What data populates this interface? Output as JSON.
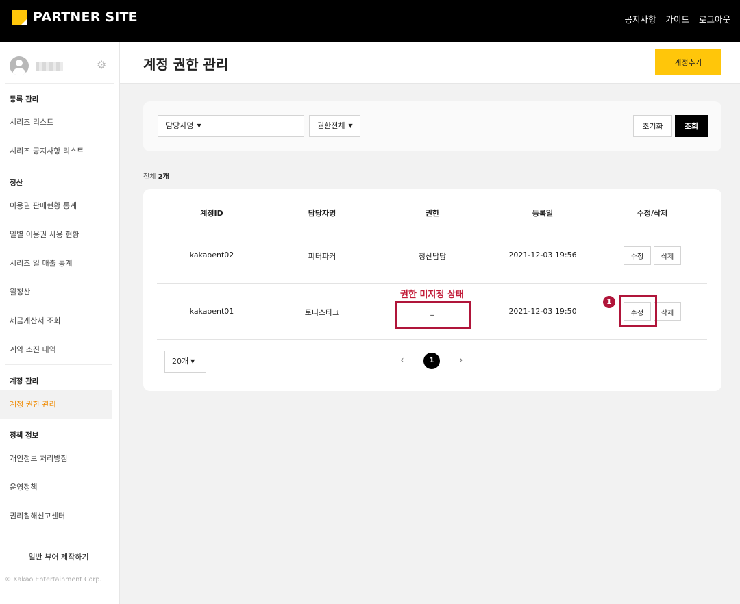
{
  "header": {
    "brand": "PARTNER SITE",
    "nav": [
      "공지사항",
      "가이드",
      "로그아웃"
    ]
  },
  "sidebar": {
    "sections": [
      {
        "title": "등록 관리",
        "items": [
          "시리즈 리스트",
          "시리즈 공지사항 리스트"
        ]
      },
      {
        "title": "정산",
        "items": [
          "이용권 판매현황 통계",
          "일별 이용권 사용 현황",
          "시리즈 일 매출 통계",
          "월정산",
          "세금계산서 조회",
          "계약 소진 내역"
        ]
      },
      {
        "title": "계정 관리",
        "items": [
          "계정 권한 관리"
        ]
      },
      {
        "title": "정책 정보",
        "items": [
          "개인정보 처리방침",
          "운영정책",
          "권리침해신고센터"
        ]
      }
    ],
    "active_item": "계정 권한 관리",
    "make_button": "일반 뷰어 제작하기",
    "copyright": "© Kakao Entertainment Corp."
  },
  "main": {
    "title": "계정 권한 관리",
    "add_button": "계정추가",
    "filters": {
      "manager_select": "담당자명",
      "role_select": "권한전체",
      "reset_button": "초기화",
      "search_button": "조회"
    },
    "total_label": "전체",
    "total_count": "2개",
    "table": {
      "columns": [
        "계정ID",
        "담당자명",
        "권한",
        "등록일",
        "수정/삭제"
      ],
      "rows": [
        {
          "id": "kakaoent02",
          "manager": "피터파커",
          "role": "정산담당",
          "date": "2021-12-03 19:56",
          "edit": "수정",
          "delete": "삭제"
        },
        {
          "id": "kakaoent01",
          "manager": "토니스타크",
          "role": "_",
          "date": "2021-12-03 19:50",
          "edit": "수정",
          "delete": "삭제"
        }
      ]
    },
    "pagination": {
      "per_page": "20개",
      "prev": "‹",
      "current": "1",
      "next": "›"
    }
  },
  "annotations": {
    "role_unset_label": "권한 미지정 상태",
    "step_badge": "1"
  },
  "colors": {
    "accent": "#ffc60a",
    "active_menu": "#ef8a00",
    "annotation": "#b0153a"
  }
}
